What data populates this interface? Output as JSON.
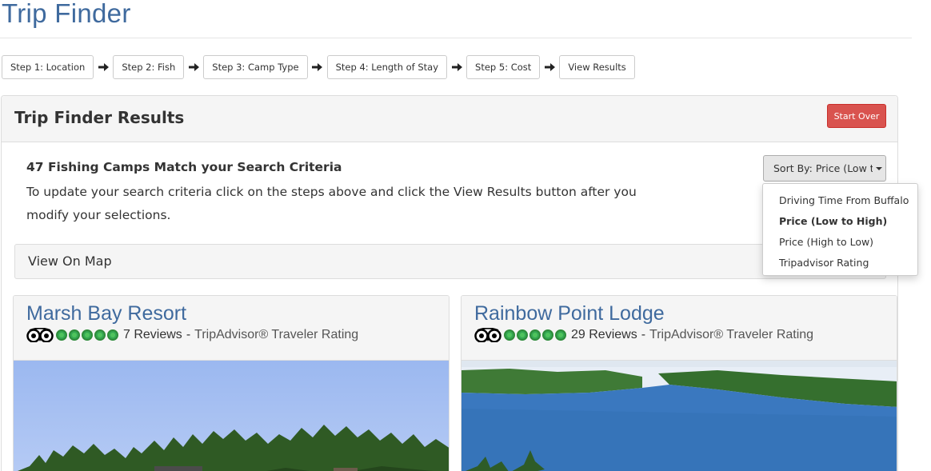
{
  "page": {
    "title": "Trip Finder"
  },
  "steps": [
    {
      "label": "Step 1: Location"
    },
    {
      "label": "Step 2: Fish"
    },
    {
      "label": "Step 3: Camp Type"
    },
    {
      "label": "Step 4: Length of Stay"
    },
    {
      "label": "Step 5: Cost"
    },
    {
      "label": "View Results"
    }
  ],
  "results": {
    "title": "Trip Finder Results",
    "start_over_label": "Start Over",
    "match_count": "47 Fishing Camps Match your Search Criteria",
    "instructions": "To update your search criteria click on the steps above and click the View Results button after you modify your selections.",
    "sort_button_label": "Sort By: Price (Low t",
    "sort_options": [
      {
        "label": "Driving Time From Buffalo",
        "selected": false
      },
      {
        "label": "Price (Low to High)",
        "selected": true
      },
      {
        "label": "Price (High to Low)",
        "selected": false
      },
      {
        "label": "Tripadvisor Rating",
        "selected": false
      }
    ],
    "view_on_map_label": "View On Map"
  },
  "camps": [
    {
      "name": "Marsh Bay Resort",
      "reviews": "7 Reviews",
      "rating_source": "TripAdvisor® Traveler Rating",
      "rating": 5
    },
    {
      "name": "Rainbow Point Lodge",
      "reviews": "29 Reviews",
      "rating_source": "TripAdvisor® Traveler Rating",
      "rating": 5
    }
  ],
  "colors": {
    "brand_blue": "#3f6a9e",
    "danger": "#d9534f",
    "rating_green": "#34a853"
  }
}
